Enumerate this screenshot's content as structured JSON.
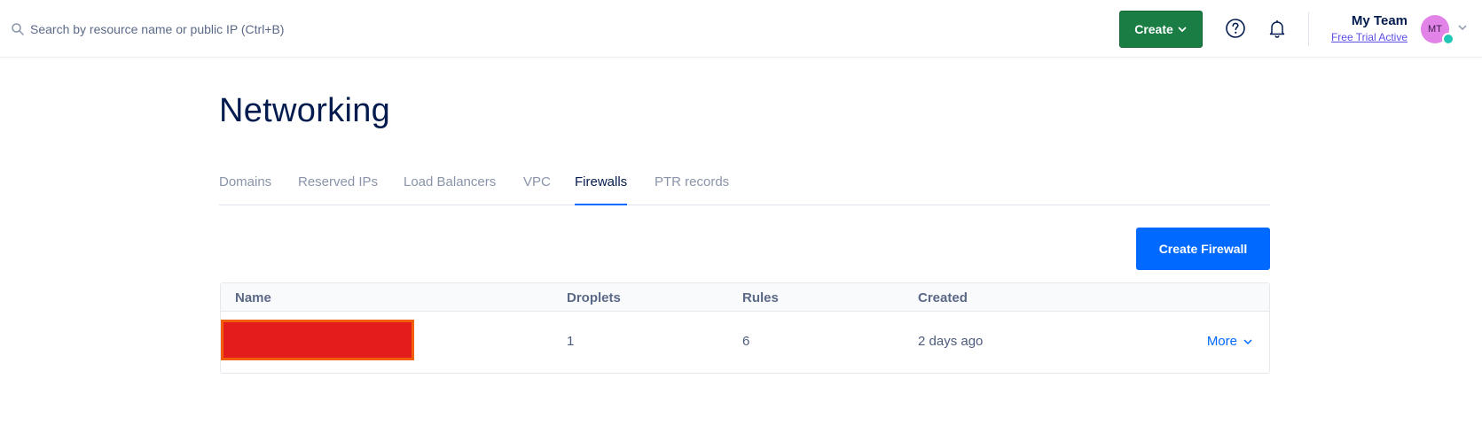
{
  "search": {
    "placeholder": "Search by resource name or public IP (Ctrl+B)",
    "value": ""
  },
  "header": {
    "create_label": "Create",
    "team_name": "My Team",
    "trial_label": "Free Trial Active",
    "avatar_initials": "MT"
  },
  "page": {
    "title": "Networking"
  },
  "tabs": [
    {
      "label": "Domains",
      "active": false
    },
    {
      "label": "Reserved IPs",
      "active": false
    },
    {
      "label": "Load Balancers",
      "active": false
    },
    {
      "label": "VPC",
      "active": false
    },
    {
      "label": "Firewalls",
      "active": true
    },
    {
      "label": "PTR records",
      "active": false
    }
  ],
  "actions": {
    "create_firewall_label": "Create Firewall"
  },
  "table": {
    "columns": [
      "Name",
      "Droplets",
      "Rules",
      "Created"
    ],
    "rows": [
      {
        "name": "",
        "droplets": "1",
        "rules": "6",
        "created": "2 days ago",
        "more_label": "More"
      }
    ]
  },
  "colors": {
    "create_button": "#1a7d43",
    "primary": "#0069ff",
    "active_tab": "#031b4e",
    "redaction_fill": "#e51c1c",
    "redaction_border": "#f25e0a",
    "avatar": "#e283e8",
    "avatar_badge": "#21c7b6"
  },
  "icons": {
    "search": "search-icon",
    "help": "help-circle-icon",
    "notifications": "bell-icon",
    "dropdown": "chevron-down-icon"
  }
}
